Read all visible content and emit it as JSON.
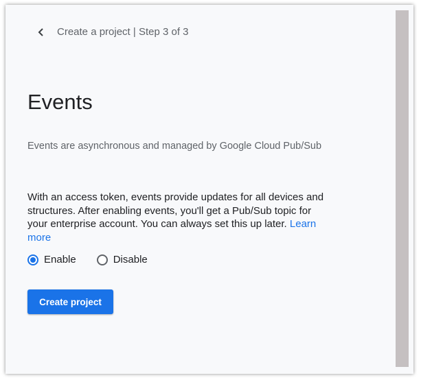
{
  "header": {
    "breadcrumb": "Create a project | Step 3 of 3"
  },
  "page": {
    "title": "Events",
    "subtitle": "Events are asynchronous and managed by Google Cloud Pub/Sub",
    "description": "With an access token, events provide updates for all devices and structures. After enabling events, you'll get a Pub/Sub topic for your enterprise account. You can always set this up later.",
    "learn_more_label": "Learn more"
  },
  "options": {
    "enable_label": "Enable",
    "disable_label": "Disable",
    "selected": "Enable"
  },
  "actions": {
    "create_label": "Create project"
  },
  "colors": {
    "accent": "#1a73e8",
    "text": "#202124",
    "muted": "#5f6368"
  },
  "icons": {
    "back": "chevron-left-icon"
  }
}
